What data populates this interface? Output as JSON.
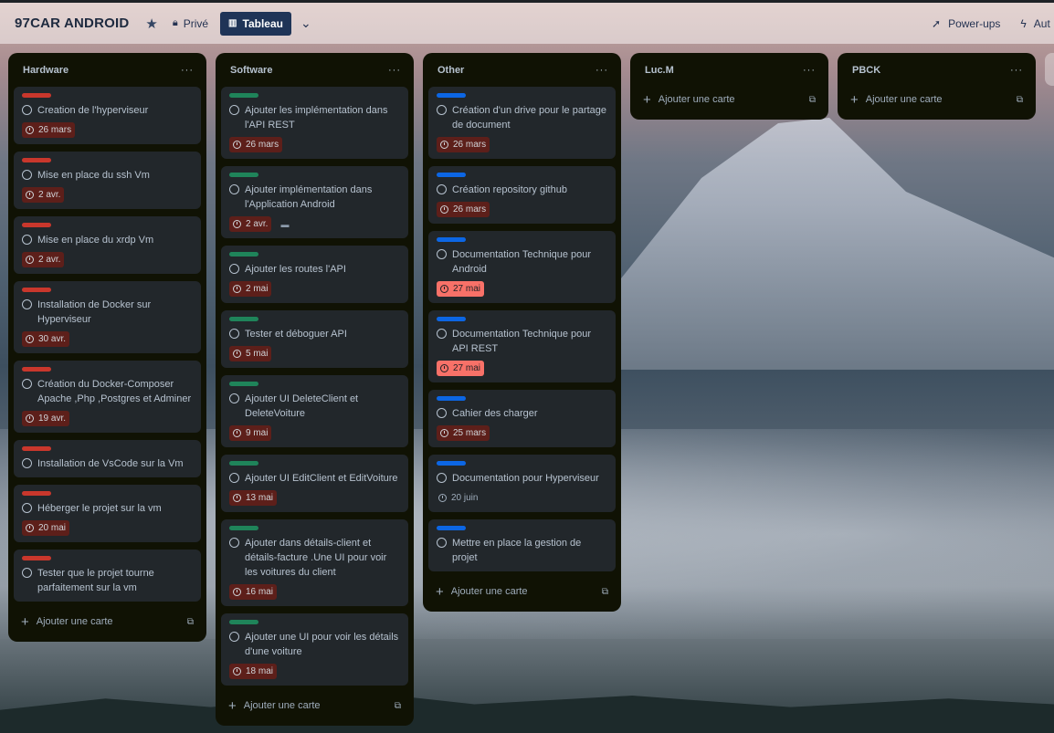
{
  "board": {
    "title": "97CAR ANDROID",
    "visibility": "Privé",
    "view_label": "Tableau",
    "powerups_label": "Power-ups",
    "automation_label": "Aut"
  },
  "icons": {
    "star": "star-icon",
    "privacy": "lock-icon",
    "view": "board-icon",
    "chevron": "chevron-down-icon",
    "powerups": "rocket-icon",
    "automation": "lightning-icon",
    "list_menu": "ellipsis-icon",
    "add": "plus-icon",
    "template": "template-icon",
    "due": "clock-icon",
    "comment": "comment-icon",
    "complete": "circle-icon"
  },
  "colors": {
    "label_red": "#c9372c",
    "label_green": "#1f845a",
    "label_blue": "#0c66e4",
    "due_overdue": "#5d1f1a",
    "due_soon": "#f87168",
    "list_bg": "#101204",
    "card_bg": "#22272b"
  },
  "add_card_label": "Ajouter une carte",
  "lists": [
    {
      "title": "Hardware",
      "cards": [
        {
          "label": "red",
          "title": "Creation de l'hyperviseur",
          "due": "26 mars",
          "due_style": "overdue"
        },
        {
          "label": "red",
          "title": "Mise en place du ssh Vm",
          "due": "2 avr.",
          "due_style": "overdue"
        },
        {
          "label": "red",
          "title": "Mise en place du xrdp Vm",
          "due": "2 avr.",
          "due_style": "overdue"
        },
        {
          "label": "red",
          "title": "Installation de Docker sur Hyperviseur",
          "due": "30 avr.",
          "due_style": "overdue"
        },
        {
          "label": "red",
          "title": "Création du Docker-Composer Apache ,Php ,Postgres et Adminer",
          "due": "19 avr.",
          "due_style": "overdue"
        },
        {
          "label": "red",
          "title": "Installation de VsCode sur la Vm",
          "due": "",
          "due_style": "none"
        },
        {
          "label": "red",
          "title": "Héberger le projet sur la vm",
          "due": "20 mai",
          "due_style": "overdue"
        },
        {
          "label": "red",
          "title": "Tester que le projet tourne parfaitement sur la vm",
          "due": "",
          "due_style": "none"
        }
      ]
    },
    {
      "title": "Software",
      "cards": [
        {
          "label": "green",
          "title": "Ajouter les implémentation dans l'API REST",
          "due": "26 mars",
          "due_style": "overdue"
        },
        {
          "label": "green",
          "title": "Ajouter implémentation dans l'Application Android",
          "due": "2 avr.",
          "due_style": "overdue",
          "comment": true
        },
        {
          "label": "green",
          "title": "Ajouter les routes l'API",
          "due": "2 mai",
          "due_style": "overdue"
        },
        {
          "label": "green",
          "title": "Tester et déboguer API",
          "due": "5 mai",
          "due_style": "overdue"
        },
        {
          "label": "green",
          "title": "Ajouter UI DeleteClient et DeleteVoiture",
          "due": "9 mai",
          "due_style": "overdue"
        },
        {
          "label": "green",
          "title": "Ajouter UI EditClient et EditVoiture",
          "due": "13 mai",
          "due_style": "overdue"
        },
        {
          "label": "green",
          "title": "Ajouter dans détails-client et détails-facture .Une UI pour voir les voitures du client",
          "due": "16 mai",
          "due_style": "overdue"
        },
        {
          "label": "green",
          "title": "Ajouter une UI pour voir les détails d'une voiture",
          "due": "18 mai",
          "due_style": "overdue"
        }
      ]
    },
    {
      "title": "Other",
      "cards": [
        {
          "label": "blue",
          "title": "Création d'un drive pour le partage de document",
          "due": "26 mars",
          "due_style": "overdue"
        },
        {
          "label": "blue",
          "title": "Création repository github",
          "due": "26 mars",
          "due_style": "overdue"
        },
        {
          "label": "blue",
          "title": "Documentation Technique pour Android",
          "due": "27 mai",
          "due_style": "soon"
        },
        {
          "label": "blue",
          "title": "Documentation Technique pour API REST",
          "due": "27 mai",
          "due_style": "soon"
        },
        {
          "label": "blue",
          "title": "Cahier des charger",
          "due": "25 mars",
          "due_style": "overdue"
        },
        {
          "label": "blue",
          "title": "Documentation pour Hyperviseur",
          "due": "20 juin",
          "due_style": "plain"
        },
        {
          "label": "blue",
          "title": "Mettre en place la gestion de projet",
          "due": "",
          "due_style": "none"
        }
      ]
    },
    {
      "title": "Luc.M",
      "cards": []
    },
    {
      "title": "PBCK",
      "cards": []
    }
  ]
}
